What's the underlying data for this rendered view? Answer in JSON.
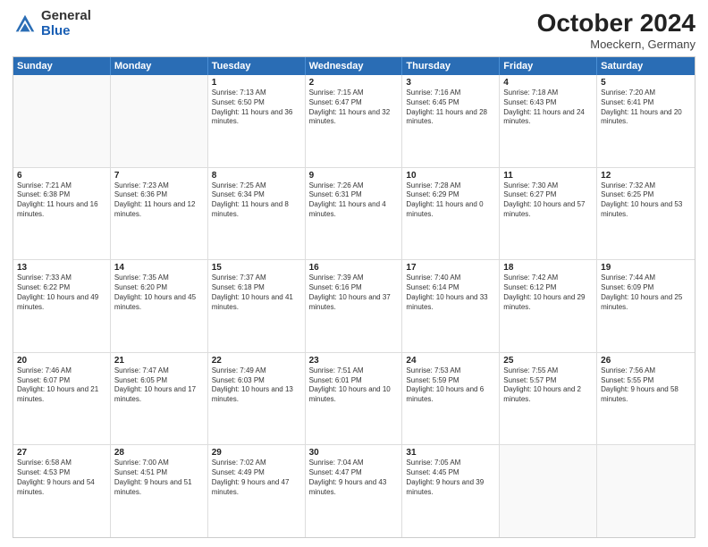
{
  "header": {
    "logo": {
      "general": "General",
      "blue": "Blue"
    },
    "title": "October 2024",
    "location": "Moeckern, Germany"
  },
  "weekdays": [
    "Sunday",
    "Monday",
    "Tuesday",
    "Wednesday",
    "Thursday",
    "Friday",
    "Saturday"
  ],
  "weeks": [
    [
      {
        "day": "",
        "sunrise": "",
        "sunset": "",
        "daylight": "",
        "empty": true
      },
      {
        "day": "",
        "sunrise": "",
        "sunset": "",
        "daylight": "",
        "empty": true
      },
      {
        "day": "1",
        "sunrise": "Sunrise: 7:13 AM",
        "sunset": "Sunset: 6:50 PM",
        "daylight": "Daylight: 11 hours and 36 minutes.",
        "empty": false
      },
      {
        "day": "2",
        "sunrise": "Sunrise: 7:15 AM",
        "sunset": "Sunset: 6:47 PM",
        "daylight": "Daylight: 11 hours and 32 minutes.",
        "empty": false
      },
      {
        "day": "3",
        "sunrise": "Sunrise: 7:16 AM",
        "sunset": "Sunset: 6:45 PM",
        "daylight": "Daylight: 11 hours and 28 minutes.",
        "empty": false
      },
      {
        "day": "4",
        "sunrise": "Sunrise: 7:18 AM",
        "sunset": "Sunset: 6:43 PM",
        "daylight": "Daylight: 11 hours and 24 minutes.",
        "empty": false
      },
      {
        "day": "5",
        "sunrise": "Sunrise: 7:20 AM",
        "sunset": "Sunset: 6:41 PM",
        "daylight": "Daylight: 11 hours and 20 minutes.",
        "empty": false
      }
    ],
    [
      {
        "day": "6",
        "sunrise": "Sunrise: 7:21 AM",
        "sunset": "Sunset: 6:38 PM",
        "daylight": "Daylight: 11 hours and 16 minutes.",
        "empty": false
      },
      {
        "day": "7",
        "sunrise": "Sunrise: 7:23 AM",
        "sunset": "Sunset: 6:36 PM",
        "daylight": "Daylight: 11 hours and 12 minutes.",
        "empty": false
      },
      {
        "day": "8",
        "sunrise": "Sunrise: 7:25 AM",
        "sunset": "Sunset: 6:34 PM",
        "daylight": "Daylight: 11 hours and 8 minutes.",
        "empty": false
      },
      {
        "day": "9",
        "sunrise": "Sunrise: 7:26 AM",
        "sunset": "Sunset: 6:31 PM",
        "daylight": "Daylight: 11 hours and 4 minutes.",
        "empty": false
      },
      {
        "day": "10",
        "sunrise": "Sunrise: 7:28 AM",
        "sunset": "Sunset: 6:29 PM",
        "daylight": "Daylight: 11 hours and 0 minutes.",
        "empty": false
      },
      {
        "day": "11",
        "sunrise": "Sunrise: 7:30 AM",
        "sunset": "Sunset: 6:27 PM",
        "daylight": "Daylight: 10 hours and 57 minutes.",
        "empty": false
      },
      {
        "day": "12",
        "sunrise": "Sunrise: 7:32 AM",
        "sunset": "Sunset: 6:25 PM",
        "daylight": "Daylight: 10 hours and 53 minutes.",
        "empty": false
      }
    ],
    [
      {
        "day": "13",
        "sunrise": "Sunrise: 7:33 AM",
        "sunset": "Sunset: 6:22 PM",
        "daylight": "Daylight: 10 hours and 49 minutes.",
        "empty": false
      },
      {
        "day": "14",
        "sunrise": "Sunrise: 7:35 AM",
        "sunset": "Sunset: 6:20 PM",
        "daylight": "Daylight: 10 hours and 45 minutes.",
        "empty": false
      },
      {
        "day": "15",
        "sunrise": "Sunrise: 7:37 AM",
        "sunset": "Sunset: 6:18 PM",
        "daylight": "Daylight: 10 hours and 41 minutes.",
        "empty": false
      },
      {
        "day": "16",
        "sunrise": "Sunrise: 7:39 AM",
        "sunset": "Sunset: 6:16 PM",
        "daylight": "Daylight: 10 hours and 37 minutes.",
        "empty": false
      },
      {
        "day": "17",
        "sunrise": "Sunrise: 7:40 AM",
        "sunset": "Sunset: 6:14 PM",
        "daylight": "Daylight: 10 hours and 33 minutes.",
        "empty": false
      },
      {
        "day": "18",
        "sunrise": "Sunrise: 7:42 AM",
        "sunset": "Sunset: 6:12 PM",
        "daylight": "Daylight: 10 hours and 29 minutes.",
        "empty": false
      },
      {
        "day": "19",
        "sunrise": "Sunrise: 7:44 AM",
        "sunset": "Sunset: 6:09 PM",
        "daylight": "Daylight: 10 hours and 25 minutes.",
        "empty": false
      }
    ],
    [
      {
        "day": "20",
        "sunrise": "Sunrise: 7:46 AM",
        "sunset": "Sunset: 6:07 PM",
        "daylight": "Daylight: 10 hours and 21 minutes.",
        "empty": false
      },
      {
        "day": "21",
        "sunrise": "Sunrise: 7:47 AM",
        "sunset": "Sunset: 6:05 PM",
        "daylight": "Daylight: 10 hours and 17 minutes.",
        "empty": false
      },
      {
        "day": "22",
        "sunrise": "Sunrise: 7:49 AM",
        "sunset": "Sunset: 6:03 PM",
        "daylight": "Daylight: 10 hours and 13 minutes.",
        "empty": false
      },
      {
        "day": "23",
        "sunrise": "Sunrise: 7:51 AM",
        "sunset": "Sunset: 6:01 PM",
        "daylight": "Daylight: 10 hours and 10 minutes.",
        "empty": false
      },
      {
        "day": "24",
        "sunrise": "Sunrise: 7:53 AM",
        "sunset": "Sunset: 5:59 PM",
        "daylight": "Daylight: 10 hours and 6 minutes.",
        "empty": false
      },
      {
        "day": "25",
        "sunrise": "Sunrise: 7:55 AM",
        "sunset": "Sunset: 5:57 PM",
        "daylight": "Daylight: 10 hours and 2 minutes.",
        "empty": false
      },
      {
        "day": "26",
        "sunrise": "Sunrise: 7:56 AM",
        "sunset": "Sunset: 5:55 PM",
        "daylight": "Daylight: 9 hours and 58 minutes.",
        "empty": false
      }
    ],
    [
      {
        "day": "27",
        "sunrise": "Sunrise: 6:58 AM",
        "sunset": "Sunset: 4:53 PM",
        "daylight": "Daylight: 9 hours and 54 minutes.",
        "empty": false
      },
      {
        "day": "28",
        "sunrise": "Sunrise: 7:00 AM",
        "sunset": "Sunset: 4:51 PM",
        "daylight": "Daylight: 9 hours and 51 minutes.",
        "empty": false
      },
      {
        "day": "29",
        "sunrise": "Sunrise: 7:02 AM",
        "sunset": "Sunset: 4:49 PM",
        "daylight": "Daylight: 9 hours and 47 minutes.",
        "empty": false
      },
      {
        "day": "30",
        "sunrise": "Sunrise: 7:04 AM",
        "sunset": "Sunset: 4:47 PM",
        "daylight": "Daylight: 9 hours and 43 minutes.",
        "empty": false
      },
      {
        "day": "31",
        "sunrise": "Sunrise: 7:05 AM",
        "sunset": "Sunset: 4:45 PM",
        "daylight": "Daylight: 9 hours and 39 minutes.",
        "empty": false
      },
      {
        "day": "",
        "sunrise": "",
        "sunset": "",
        "daylight": "",
        "empty": true
      },
      {
        "day": "",
        "sunrise": "",
        "sunset": "",
        "daylight": "",
        "empty": true
      }
    ]
  ]
}
